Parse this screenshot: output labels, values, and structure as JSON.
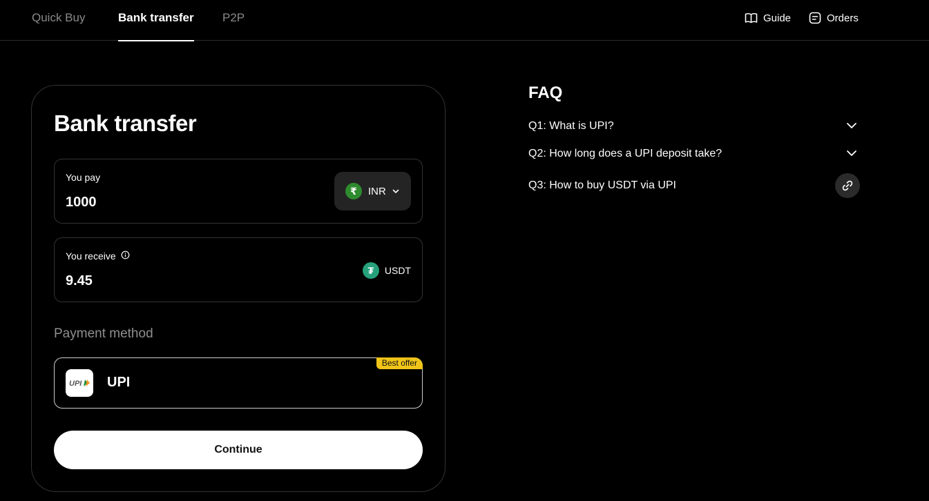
{
  "nav": {
    "tabs": [
      {
        "label": "Quick Buy",
        "active": false
      },
      {
        "label": "Bank transfer",
        "active": true
      },
      {
        "label": "P2P",
        "active": false
      }
    ],
    "guide_label": "Guide",
    "orders_label": "Orders"
  },
  "card": {
    "title": "Bank transfer",
    "pay": {
      "label": "You pay",
      "value": "1000",
      "currency": "INR",
      "currency_icon": "rupee-coin-icon",
      "currency_symbol": "₹"
    },
    "receive": {
      "label": "You receive",
      "value": "9.45",
      "currency": "USDT",
      "currency_icon": "tether-coin-icon",
      "currency_symbol": "₮"
    },
    "payment_method": {
      "label": "Payment method",
      "name": "UPI",
      "badge": "Best offer",
      "logo_text": "UPI"
    },
    "continue_label": "Continue"
  },
  "faq": {
    "title": "FAQ",
    "items": [
      {
        "question": "Q1: What is UPI?",
        "icon": "chevron-down-icon"
      },
      {
        "question": "Q2: How long does a UPI deposit take?",
        "icon": "chevron-down-icon"
      },
      {
        "question": "Q3: How to buy USDT via UPI",
        "icon": "link-icon"
      }
    ]
  },
  "colors": {
    "background": "#000000",
    "accent_badge": "#f0c419",
    "rupee_green": "#2e8b2e",
    "tether_green": "#26a17b"
  }
}
